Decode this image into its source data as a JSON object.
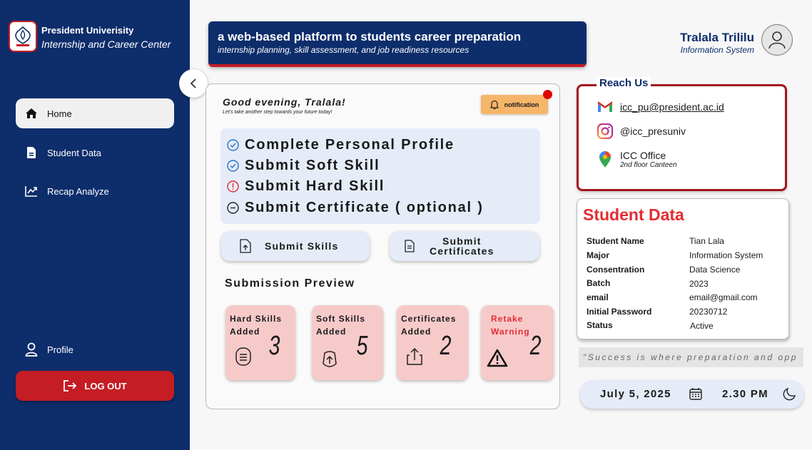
{
  "brand": {
    "title": "President Univerisity",
    "subtitle": "Internship and Career Center",
    "logo_icon": "university-crest-icon"
  },
  "sidebar": {
    "items": [
      {
        "label": "Home",
        "icon": "home-icon",
        "active": true
      },
      {
        "label": "Student Data",
        "icon": "document-icon",
        "active": false
      },
      {
        "label": "Recap Analyze",
        "icon": "chart-icon",
        "active": false
      }
    ],
    "profile_label": "Profile",
    "logout_label": "LOG OUT"
  },
  "banner": {
    "title": "a web-based platform to students career preparation",
    "subtitle": "internship planning, skill assessment, and job readiness resources"
  },
  "user": {
    "name": "Tralala Trililu",
    "role": "Information System"
  },
  "greeting": {
    "title": "Good evening, Tralala!",
    "subtitle": "Let's take another step towards your future today!"
  },
  "notification_label": "notification",
  "checklist": [
    {
      "label": "Complete Personal Profile",
      "status": "done"
    },
    {
      "label": "Submit Soft Skill",
      "status": "done"
    },
    {
      "label": "Submit Hard Skill",
      "status": "warning"
    },
    {
      "label": "Submit Certificate ( optional )",
      "status": "optional"
    }
  ],
  "actions": {
    "submit_skills": "Submit Skills",
    "submit_certificates_line1": "Submit",
    "submit_certificates_line2": "Certificates"
  },
  "preview": {
    "title": "Submission Preview",
    "cards": [
      {
        "line1": "Hard Skills",
        "line2": "Added",
        "value": "3",
        "icon": "list-icon",
        "warning": false
      },
      {
        "line1": "Soft Skills",
        "line2": "Added",
        "value": "5",
        "icon": "mouse-upload-icon",
        "warning": false
      },
      {
        "line1": "Certificates",
        "line2": "Added",
        "value": "2",
        "icon": "share-upload-icon",
        "warning": false
      },
      {
        "line1": "Retake",
        "line2": "Warning",
        "value": "2",
        "icon": "warning-triangle-icon",
        "warning": true
      }
    ]
  },
  "reach_us": {
    "title": "Reach Us",
    "email": "icc_pu@president.ac.id",
    "instagram": "@icc_presuniv",
    "office": "ICC Office",
    "office_sub": "2nd floor Canteen"
  },
  "student_data": {
    "title": "Student Data",
    "rows": [
      {
        "key": "Student Name",
        "value": "Tian Lala"
      },
      {
        "key": "Major",
        "value": "Information System"
      },
      {
        "key": "Consentration",
        "value": "Data Science"
      },
      {
        "key": "Batch",
        "value": "2023"
      },
      {
        "key": "email",
        "value": "email@gmail.com"
      },
      {
        "key": "Initial Password",
        "value": "20230712"
      },
      {
        "key": "Status",
        "value": "Active"
      }
    ]
  },
  "quote": "\"Success is where preparation and opp",
  "datetime": {
    "date": "July 5, 2025",
    "time": "2.30 PM"
  },
  "colors": {
    "navy": "#0d2d6b",
    "red": "#c41d24",
    "accent_red": "#e32c32",
    "card_pink": "#f7caca",
    "light_blue": "#e5ecf8",
    "notification": "#f6b66a"
  }
}
